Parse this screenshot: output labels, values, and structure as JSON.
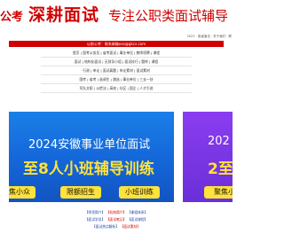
{
  "header": {
    "logo_small": "公考",
    "logo_big": "深耕面试",
    "slogan": "专注公职类面试辅导",
    "dateline": "2023 · 各省面试 · 关于我们 · 联"
  },
  "contact_bar": "以前公考：联系邮箱xxx@gkcx.com",
  "link_rows": [
    "首页 | 国考公务员 | 省考面试 | 事业单位 | 教师招聘 | 课程",
    "面试 | 结构化面试 | 无领导小组 | 面试技巧 | 题库 | 课程",
    "行测 | 申论 | 面试真题 | 申论素材 | 面试素材",
    "国考 | 省考 | 选调生 | 遴选 | 事业单位 | 三支一扶",
    "军队文职 | 公检法 | 高校 | 社区 | 国企 | 人才引进"
  ],
  "banner_main": {
    "line1": "2024安徽事业单位面试",
    "line2": "至8人小班辅导训练",
    "pills": [
      "焦小众",
      "限额招生",
      "小班训练"
    ]
  },
  "banner_side": {
    "line1": "202",
    "line2": "2至",
    "pill": "聚焦小"
  },
  "footer": {
    "row1": [
      "【师资简介】",
      "【机构简介】",
      "【课程体系】"
    ],
    "row2": [
      "【面试学员】",
      "【面试笔记】",
      "【面试课程】"
    ],
    "row3": [
      "【面试热点解析】",
      "【面试素材】"
    ]
  },
  "colors": {
    "brand_red": "#d00000",
    "banner_blue": "#1466d8",
    "banner_purple": "#6a2fd8",
    "accent_yellow": "#ffe23a"
  }
}
